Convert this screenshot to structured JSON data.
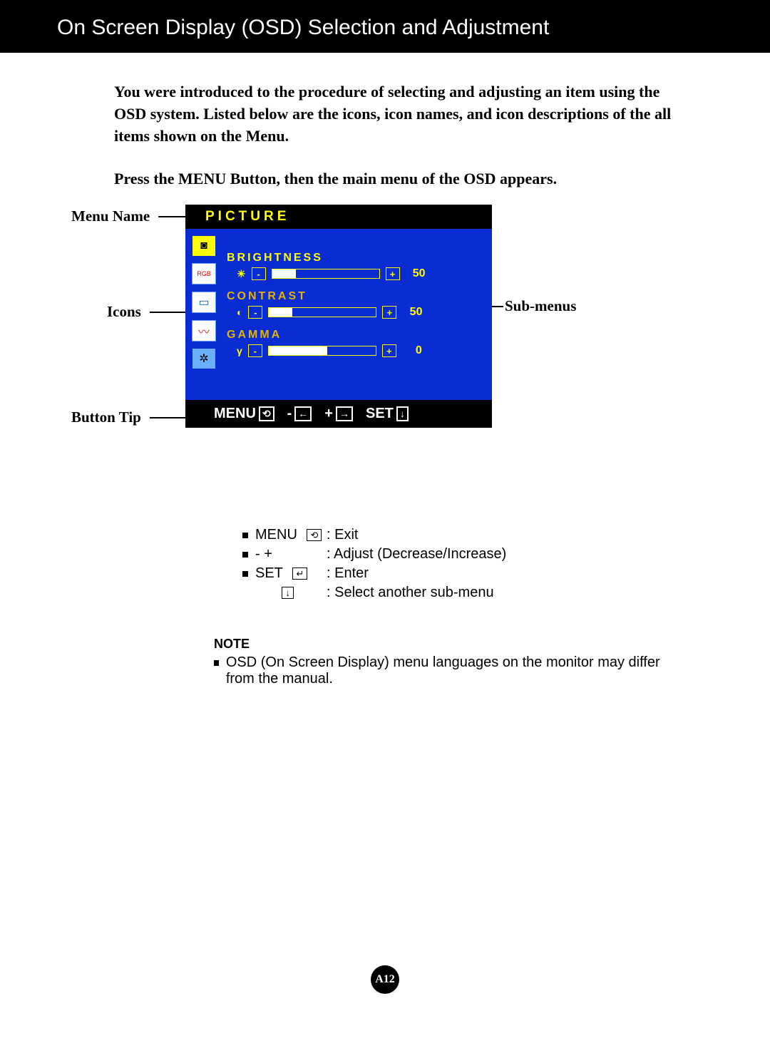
{
  "title": "On Screen Display (OSD) Selection and Adjustment",
  "intro": "You were introduced to the procedure of selecting and adjusting an item using the OSD system.  Listed below are the icons, icon names, and icon descriptions of the all items shown on the Menu.",
  "intro2": "Press the MENU Button, then the main menu of the OSD appears.",
  "labels": {
    "menu_name": "Menu Name",
    "icons": "Icons",
    "button_tip": "Button Tip",
    "sub_menus": "Sub-menus"
  },
  "osd": {
    "title": "PICTURE",
    "subs": [
      {
        "name": "BRIGHTNESS",
        "value": 50,
        "fill": 22,
        "icon": "☀"
      },
      {
        "name": "CONTRAST",
        "value": 50,
        "fill": 22,
        "icon": "◐"
      },
      {
        "name": "GAMMA",
        "value": 0,
        "fill": 55,
        "icon": "γ"
      }
    ],
    "foot": {
      "menu": "MENU",
      "minus": "-",
      "plus": "+",
      "set": "SET"
    }
  },
  "tips": [
    {
      "key": "MENU",
      "box": "⟲",
      "desc": ": Exit"
    },
    {
      "key": "-   +",
      "box": "",
      "desc": ": Adjust (Decrease/Increase)"
    },
    {
      "key": "SET",
      "box": "↵",
      "desc": ": Enter"
    },
    {
      "key": "",
      "box": "↓",
      "desc": ": Select another sub-menu"
    }
  ],
  "note": {
    "h": "NOTE",
    "text": "OSD (On Screen Display) menu languages on the monitor may differ from the manual."
  },
  "pagenum": "A12"
}
